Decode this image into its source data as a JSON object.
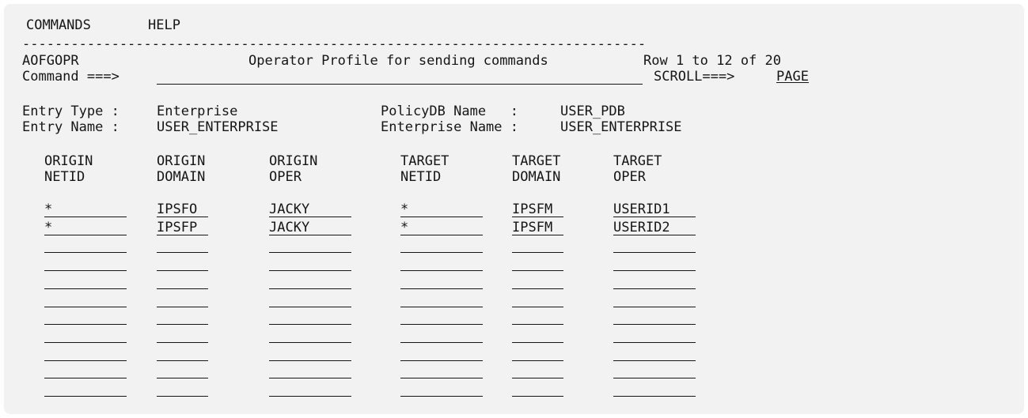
{
  "menu": {
    "commands": "COMMANDS",
    "help": "HELP"
  },
  "separator": "-----------------------------------------------------------------------------",
  "header": {
    "panel_id": "AOFGOPR",
    "title": "Operator Profile for sending commands",
    "row_info": "Row 1 to 12 of 20",
    "command_label": "Command ===>",
    "command_value": "",
    "scroll_label": "SCROLL===>",
    "scroll_value": "PAGE"
  },
  "info": {
    "entry_type_label": "Entry Type : ",
    "entry_type_value": "Enterprise",
    "entry_name_label": "Entry Name : ",
    "entry_name_value": "USER_ENTERPRISE",
    "policydb_label": "PolicyDB Name   : ",
    "policydb_value": "USER_PDB",
    "enterprise_label": "Enterprise Name : ",
    "enterprise_value": "USER_ENTERPRISE"
  },
  "table": {
    "headers": [
      {
        "line1": "ORIGIN",
        "line2": "NETID"
      },
      {
        "line1": "ORIGIN",
        "line2": "DOMAIN"
      },
      {
        "line1": "ORIGIN",
        "line2": "OPER"
      },
      {
        "line1": "TARGET",
        "line2": "NETID"
      },
      {
        "line1": "TARGET",
        "line2": "DOMAIN"
      },
      {
        "line1": "TARGET",
        "line2": "OPER"
      }
    ],
    "rows": [
      [
        "*",
        "IPSFO",
        "JACKY",
        "*",
        "IPSFM",
        "USERID1"
      ],
      [
        "*",
        "IPSFP",
        "JACKY",
        "*",
        "IPSFM",
        "USERID2"
      ],
      [
        "",
        "",
        "",
        "",
        "",
        ""
      ],
      [
        "",
        "",
        "",
        "",
        "",
        ""
      ],
      [
        "",
        "",
        "",
        "",
        "",
        ""
      ],
      [
        "",
        "",
        "",
        "",
        "",
        ""
      ],
      [
        "",
        "",
        "",
        "",
        "",
        ""
      ],
      [
        "",
        "",
        "",
        "",
        "",
        ""
      ],
      [
        "",
        "",
        "",
        "",
        "",
        ""
      ],
      [
        "",
        "",
        "",
        "",
        "",
        ""
      ],
      [
        "",
        "",
        "",
        "",
        "",
        ""
      ],
      [
        "",
        "",
        "",
        "",
        "",
        ""
      ]
    ]
  }
}
